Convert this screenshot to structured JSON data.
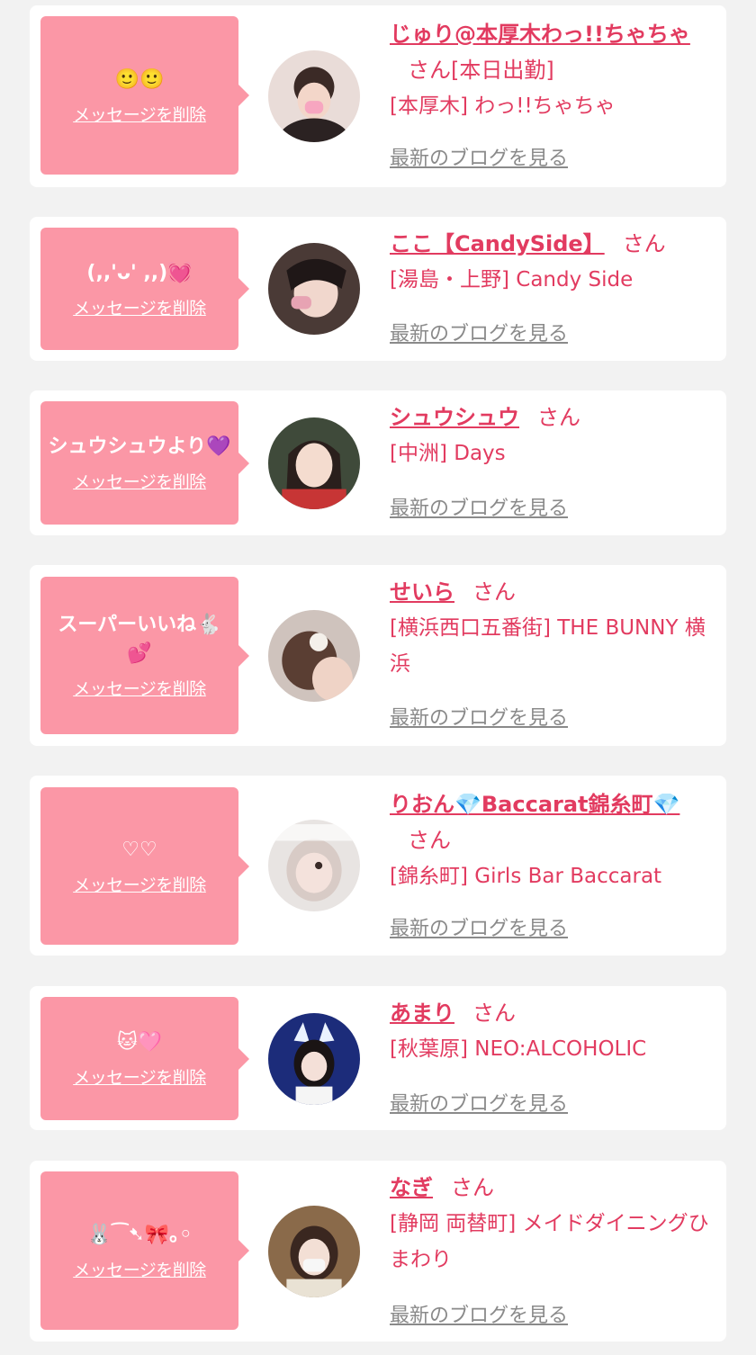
{
  "messages": [
    {
      "message": "🙂🙂",
      "delete_label": "メッセージを削除",
      "name": "じゅり@本厚木わっ!!ちゃちゃ",
      "honorific": "さん[本日出勤]",
      "shop": "[本厚木] わっ!!ちゃちゃ",
      "blog_label": "最新のブログを見る"
    },
    {
      "message": "(,,'ᴗ' ,,)💓",
      "delete_label": "メッセージを削除",
      "name": "ここ【CandySide】",
      "honorific": "さん",
      "shop": "[湯島・上野] Candy Side",
      "blog_label": "最新のブログを見る"
    },
    {
      "message": "シュウシュウより💜",
      "delete_label": "メッセージを削除",
      "name": "シュウシュウ",
      "honorific": "さん",
      "shop": "[中洲] Days",
      "blog_label": "最新のブログを見る"
    },
    {
      "message": "スーパーいいね🐇💕",
      "delete_label": "メッセージを削除",
      "name": "せいら",
      "honorific": "さん",
      "shop": "[横浜西口五番街] THE BUNNY 横浜",
      "blog_label": "最新のブログを見る"
    },
    {
      "message": "♡♡",
      "delete_label": "メッセージを削除",
      "name": "りおん💎Baccarat錦糸町💎",
      "honorific": "さん",
      "shop": "[錦糸町] Girls Bar Baccarat",
      "blog_label": "最新のブログを見る"
    },
    {
      "message": "🐱🩷",
      "delete_label": "メッセージを削除",
      "name": "あまり",
      "honorific": "さん",
      "shop": "[秋葉原] NEO:ALCOHOLIC",
      "blog_label": "最新のブログを見る"
    },
    {
      "message": "🐰⁀➷🎀｡◦",
      "delete_label": "メッセージを削除",
      "name": "なぎ",
      "honorific": "さん",
      "shop": "[静岡 両替町] メイドダイニングひまわり",
      "blog_label": "最新のブログを見る"
    }
  ],
  "colors": {
    "accent": "#e23b60",
    "bubble": "#fb97a6",
    "background": "#f2f2f2"
  }
}
